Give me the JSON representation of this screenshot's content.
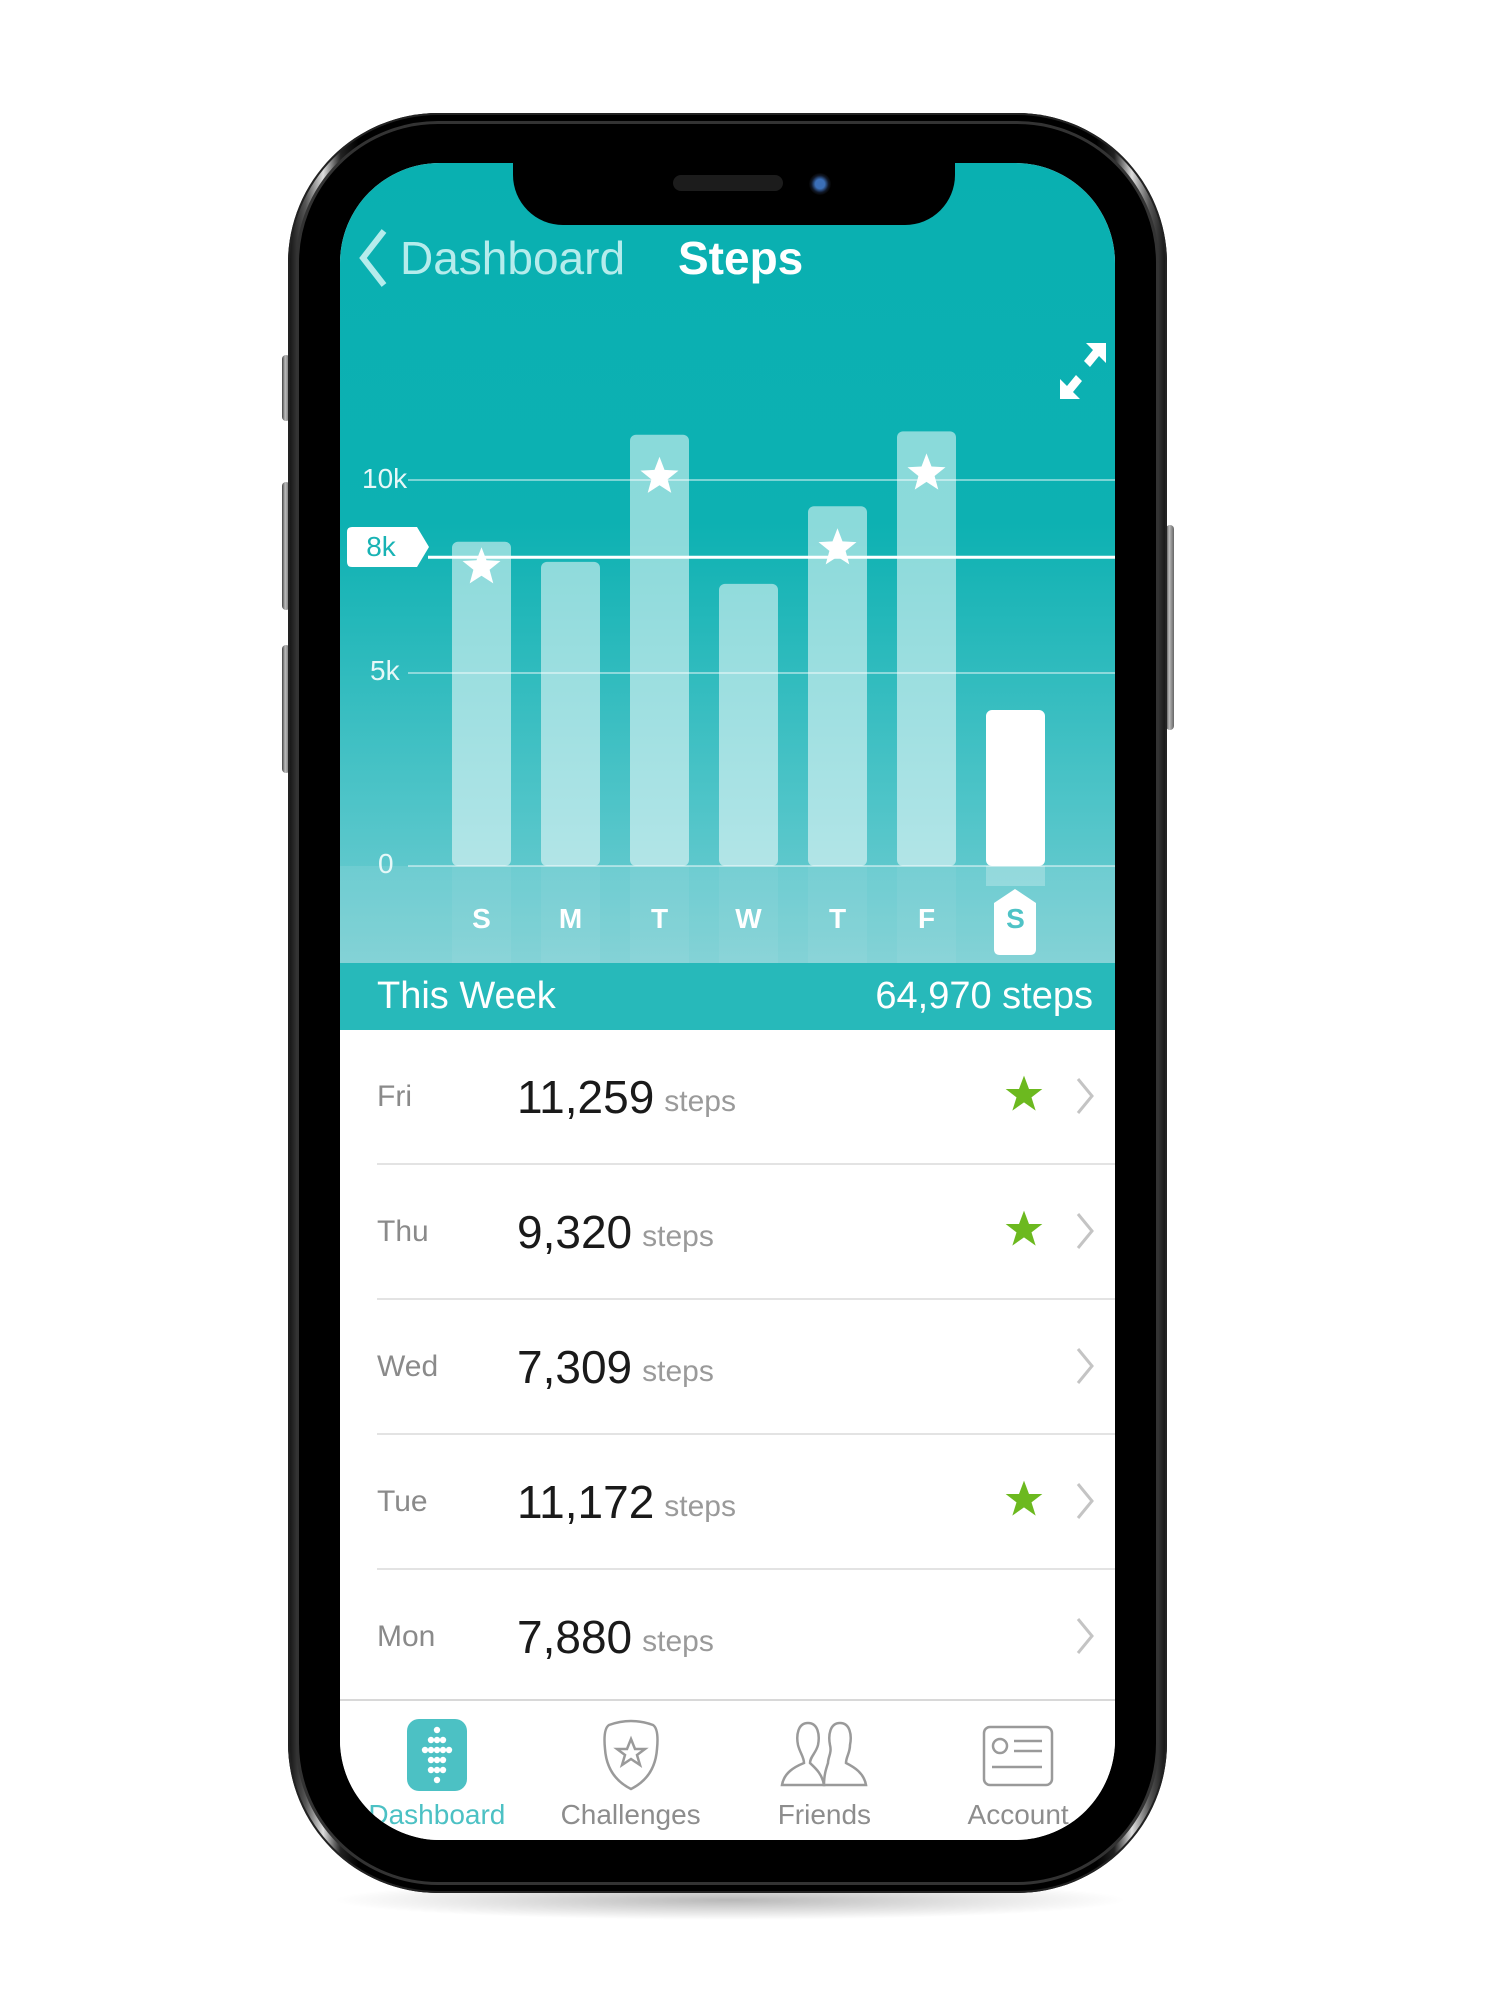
{
  "nav": {
    "back_label": "Dashboard",
    "title": "Steps",
    "expand_icon": "expand-arrows-icon"
  },
  "colors": {
    "accent": "#0db1b2",
    "band": "#27b9ba",
    "goal_star": "#6cb91f",
    "active_tab": "#4cc1c4"
  },
  "chart_data": {
    "type": "bar",
    "title": "Steps",
    "categories": [
      "S",
      "M",
      "T",
      "W",
      "T",
      "F",
      "S"
    ],
    "values": [
      8400,
      7880,
      11172,
      7309,
      9320,
      11259,
      4040
    ],
    "goal_met": [
      true,
      false,
      true,
      false,
      true,
      true,
      false
    ],
    "highlight_index": 6,
    "goal": 8000,
    "goal_label": "8k",
    "yticks": [
      0,
      5000,
      10000
    ],
    "ytick_labels": [
      "0",
      "5k",
      "10k"
    ],
    "ylim": [
      0,
      11500
    ],
    "xlabel": "",
    "ylabel": "",
    "grid": true
  },
  "summary": {
    "label": "This Week",
    "total": "64,970 steps"
  },
  "days": [
    {
      "day": "Fri",
      "steps": "11,259",
      "unit": "steps",
      "goal_met": true
    },
    {
      "day": "Thu",
      "steps": "9,320",
      "unit": "steps",
      "goal_met": true
    },
    {
      "day": "Wed",
      "steps": "7,309",
      "unit": "steps",
      "goal_met": false
    },
    {
      "day": "Tue",
      "steps": "11,172",
      "unit": "steps",
      "goal_met": true
    },
    {
      "day": "Mon",
      "steps": "7,880",
      "unit": "steps",
      "goal_met": false
    }
  ],
  "tabs": [
    {
      "label": "Dashboard",
      "icon": "fitbit-logo-icon",
      "active": true
    },
    {
      "label": "Challenges",
      "icon": "shield-star-icon",
      "active": false
    },
    {
      "label": "Friends",
      "icon": "friends-icon",
      "active": false
    },
    {
      "label": "Account",
      "icon": "id-card-icon",
      "active": false
    }
  ]
}
